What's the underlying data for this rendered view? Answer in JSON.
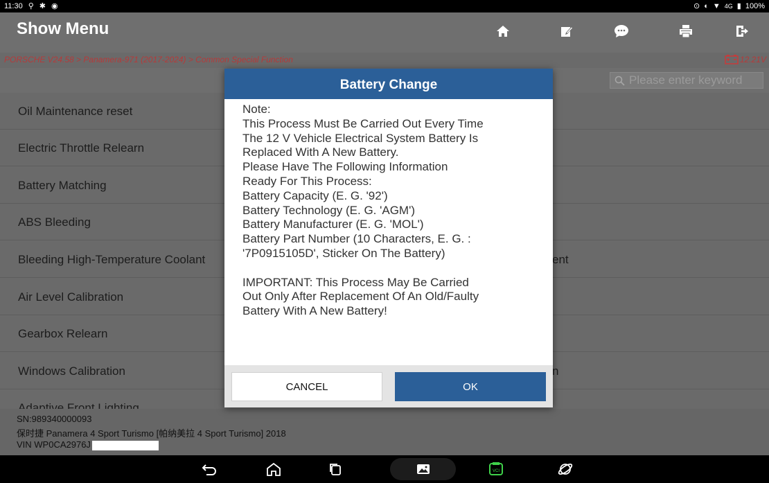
{
  "status": {
    "time": "11:30",
    "network": "4G",
    "battery": "100%"
  },
  "header": {
    "title": "Show Menu"
  },
  "breadcrumb": {
    "path": "PORSCHE V24.58 > Panamera-971 (2017-2024) > Common Special Function",
    "voltage": "12.21V"
  },
  "search": {
    "placeholder": "Please enter keyword"
  },
  "menu": {
    "rows": [
      {
        "left": "Oil Maintenance reset",
        "right": ""
      },
      {
        "left": "Electric Throttle Relearn",
        "right": ""
      },
      {
        "left": "Battery Matching",
        "right": ""
      },
      {
        "left": "ABS Bleeding",
        "right": ""
      },
      {
        "left": "Bleeding High-Temperature Coolant",
        "right": "ent"
      },
      {
        "left": "Air Level Calibration",
        "right": ""
      },
      {
        "left": "Gearbox Relearn",
        "right": ""
      },
      {
        "left": "Windows Calibration",
        "right": "n"
      },
      {
        "left": "Adaptive Front Lighting",
        "right": ""
      }
    ]
  },
  "footer": {
    "sn": "SN:989340000093",
    "vehicle": "保时捷 Panamera 4 Sport Turismo [帕纳美拉 4 Sport Turismo] 2018",
    "vin": "VIN WP0CA2976J"
  },
  "dialog": {
    "title": "Battery Change",
    "lines": [
      "Note:",
      "This Process Must Be Carried Out Every Time",
      "The 12 V Vehicle Electrical System Battery Is",
      "Replaced With A New Battery.",
      "Please Have The Following Information",
      "Ready For This Process:",
      "Battery Capacity (E. G. '92')",
      "Battery Technology (E. G. 'AGM')",
      "Battery Manufacturer (E. G. 'MOL')",
      "Battery Part Number (10 Characters, E. G. :",
      "'7P0915105D', Sticker On The Battery)",
      "",
      "IMPORTANT: This Process May Be Carried",
      "Out Only After Replacement Of An Old/Faulty",
      "Battery With A New Battery!"
    ],
    "cancel_label": "CANCEL",
    "ok_label": "OK"
  }
}
